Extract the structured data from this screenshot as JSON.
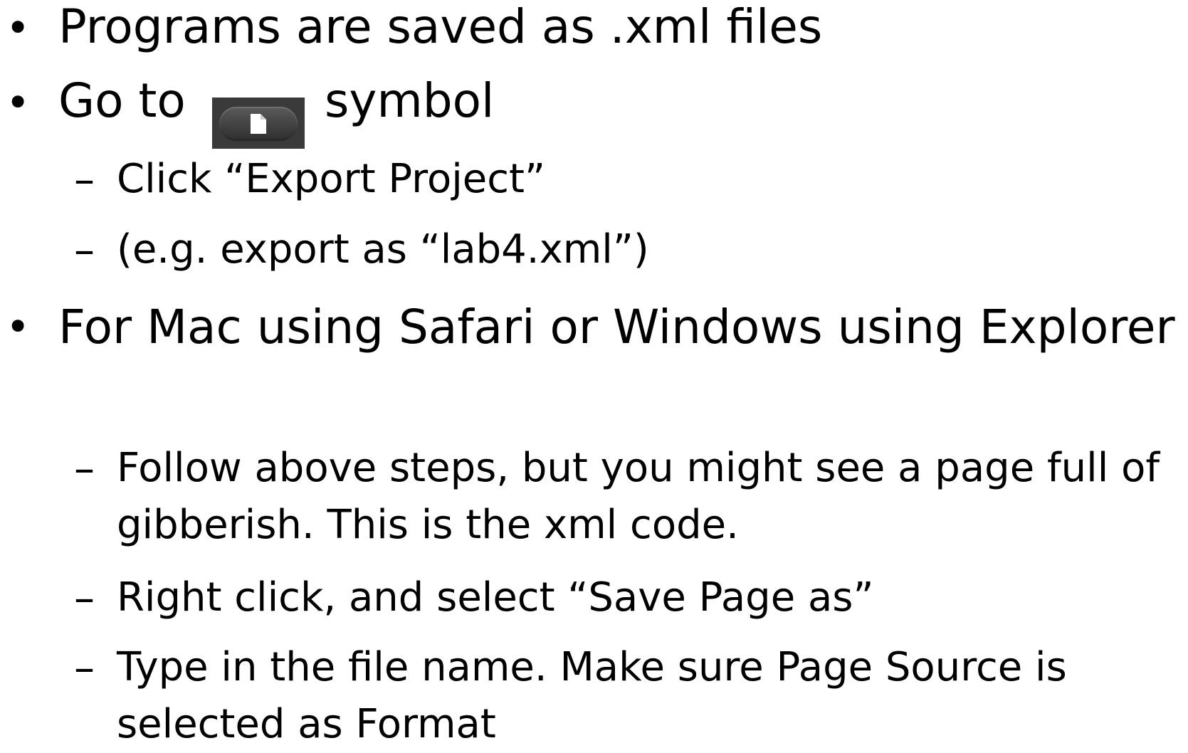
{
  "items": [
    {
      "text": "Programs are saved as .xml files"
    },
    {
      "text_before": "Go to",
      "icon": "file-icon",
      "text_after": "symbol",
      "subitems": [
        "Click “Export Project”",
        "(e.g. export as “lab4.xml”)"
      ]
    },
    {
      "text": "For Mac using Safari or Windows using Explorer",
      "subitems": [
        "Follow above steps, but you might see a page full of gibberish. This is the xml code.",
        "Right click, and select “Save Page as”",
        "Type in the file name. Make sure Page Source is selected as Format"
      ]
    }
  ],
  "glyphs": {
    "bullet": "•",
    "dash": "–"
  },
  "colors": {
    "text": "#000000",
    "background": "#ffffff",
    "icon_button": "#3a3a3a"
  }
}
